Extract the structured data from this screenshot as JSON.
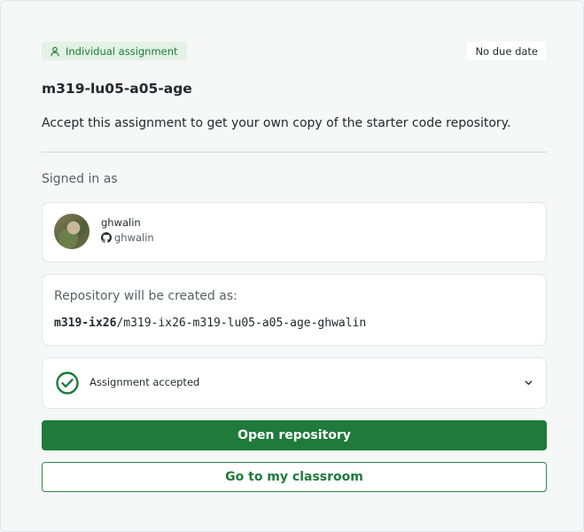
{
  "badge": {
    "label": "Individual assignment",
    "icon": "person-icon"
  },
  "due": {
    "label": "No due date"
  },
  "assignment": {
    "title": "m319-lu05-a05-age",
    "description": "Accept this assignment to get your own copy of the starter code repository."
  },
  "signed_in": {
    "heading": "Signed in as",
    "display_name": "ghwalin",
    "github_handle": "ghwalin"
  },
  "repository": {
    "label": "Repository will be created as:",
    "org": "m319-ix26",
    "separator": "/",
    "name": "m319-ix26-m319-lu05-a05-age-ghwalin"
  },
  "status": {
    "label": "Assignment accepted",
    "icon": "check-circle-icon"
  },
  "buttons": {
    "open_repo": "Open repository",
    "classroom": "Go to my classroom"
  },
  "colors": {
    "accent": "#1f7a3b",
    "badge_bg": "#e4f1e5",
    "background": "#f6f7f7"
  }
}
